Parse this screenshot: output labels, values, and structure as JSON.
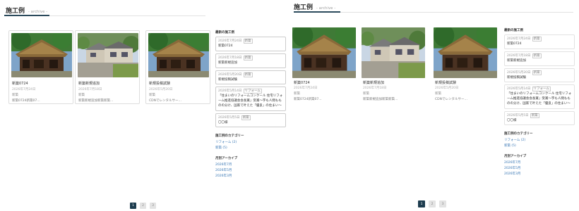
{
  "heading": {
    "title": "施工例",
    "subtitle": "- archive -"
  },
  "cards": [
    {
      "title": "新築0724",
      "date": "2026年7月24日",
      "category": "新築",
      "excerpt": "新築0724新築07…",
      "thumb": "house-thatched"
    },
    {
      "title": "新築新規追加",
      "date": "2026年7月18日",
      "category": "新築",
      "excerpt": "新築新規追加新築新築…",
      "thumb": "house-modern"
    },
    {
      "title": "新規投稿試験",
      "date": "2026年5月20日",
      "category": "新築",
      "excerpt": "CDNでレンタルサー…",
      "thumb": "house-thatched"
    }
  ],
  "sidebar": {
    "recent_heading": "最新の施工例",
    "recent_left": [
      {
        "date": "2026年7月24日",
        "tag": "新築",
        "text": "新築0724"
      },
      {
        "date": "2026年7月18日",
        "tag": "新築",
        "text": "新築新規追加"
      },
      {
        "date": "2026年5月20日",
        "tag": "新築",
        "text": "新規投稿試験"
      },
      {
        "date": "2026年5月14日",
        "tag": "リフォーム",
        "text": "「住まいのリフォームコンクール 住宅リフォーム推進協議会会長賞」受賞～字も人間もものの分け、国家で叶えた「優良」の住まい～"
      },
      {
        "date": "2026年5月5日",
        "tag": "新築",
        "text": "〇〇様"
      }
    ],
    "recent_right": [
      {
        "date": "2026年7月24日",
        "tag": "新築",
        "text": "新築0724"
      },
      {
        "date": "2026年7月18日",
        "tag": "新築",
        "text": "新築新規追加"
      },
      {
        "date": "2026年5月20日",
        "tag": "新築",
        "text": "新規投稿試験"
      },
      {
        "date": "2026年5月14日",
        "tag": "リフォーム",
        "text": "「住まいのリフォームコンクール 住宅リフォーム推進協議会会長賞」受賞～字も人間もものの分け、国家で叶えた「優良」の住まい～"
      },
      {
        "date": "2026年5月5日",
        "tag": "新築",
        "text": "〇〇様"
      }
    ],
    "category_heading": "施工例のカテゴリー",
    "categories": [
      "リフォーム (2)",
      "新築 (5)"
    ],
    "archive_heading": "月別アーカイブ",
    "archives": [
      "2026年7月",
      "2026年5月",
      "2026年3月"
    ]
  },
  "pagination": [
    "1",
    "2",
    "3"
  ],
  "colors": {
    "accent": "#1e3d4f",
    "link": "#3a78b5",
    "border": "#dddddd"
  }
}
